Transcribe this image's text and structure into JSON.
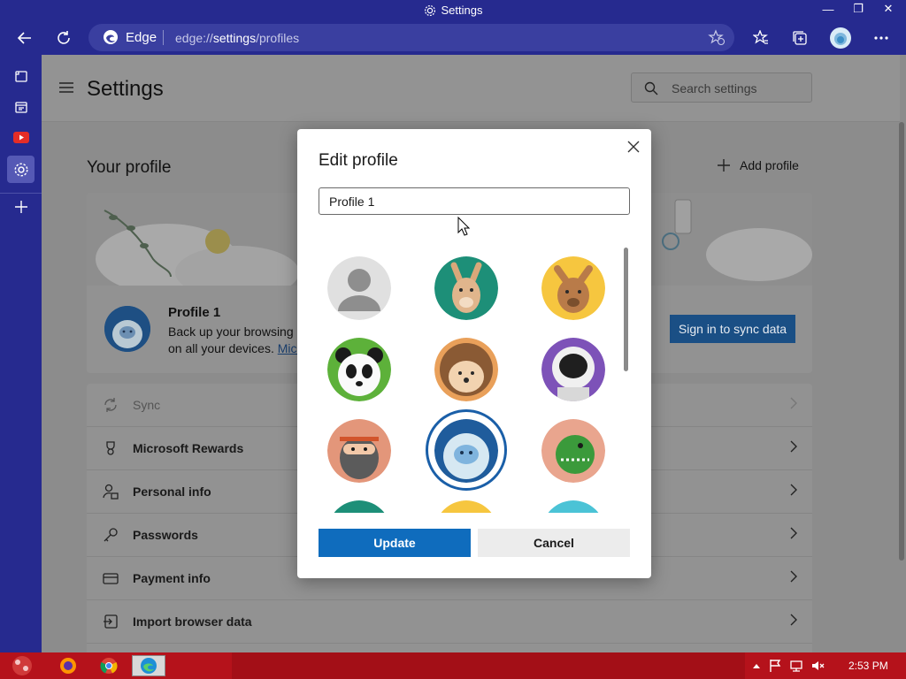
{
  "window": {
    "title": "Settings",
    "controls": [
      "minimize",
      "restore",
      "close"
    ]
  },
  "toolbar": {
    "browser_label": "Edge",
    "url_prefix": "edge://",
    "url_bold": "settings",
    "url_suffix": "/profiles"
  },
  "sidebar": {
    "items": [
      "tabs-icon",
      "collections-icon",
      "youtube-icon",
      "settings-icon",
      "add-icon"
    ]
  },
  "header": {
    "title": "Settings",
    "search_placeholder": "Search settings"
  },
  "profile_section": {
    "heading": "Your profile",
    "add_profile": "Add profile",
    "name": "Profile 1",
    "desc_line1": "Back up your browsing d",
    "desc_line2": "on all your devices.",
    "desc_link": "Micr",
    "sync_button": "Sign in to sync data"
  },
  "settings_list": [
    {
      "label": "Sync",
      "icon": "sync-icon",
      "dim": true
    },
    {
      "label": "Microsoft Rewards",
      "icon": "rewards-icon",
      "dim": false
    },
    {
      "label": "Personal info",
      "icon": "personal-info-icon",
      "dim": false
    },
    {
      "label": "Passwords",
      "icon": "key-icon",
      "dim": false
    },
    {
      "label": "Payment info",
      "icon": "card-icon",
      "dim": false
    },
    {
      "label": "Import browser data",
      "icon": "import-icon",
      "dim": false
    }
  ],
  "dialog": {
    "title": "Edit profile",
    "name_value": "Profile 1",
    "update_label": "Update",
    "cancel_label": "Cancel",
    "avatars": [
      "default-person",
      "kangaroo",
      "fox-dog",
      "panda",
      "hedgehog",
      "astronaut",
      "ninja",
      "yeti",
      "dinosaur"
    ],
    "selected_avatar": "yeti"
  },
  "taskbar": {
    "apps": [
      "firefox",
      "chrome",
      "edge"
    ],
    "active_app": "edge",
    "clock": "2:53 PM"
  },
  "colors": {
    "accent": "#0f6cbd",
    "titlebar": "#262a8f",
    "taskbar": "#b5121b"
  }
}
